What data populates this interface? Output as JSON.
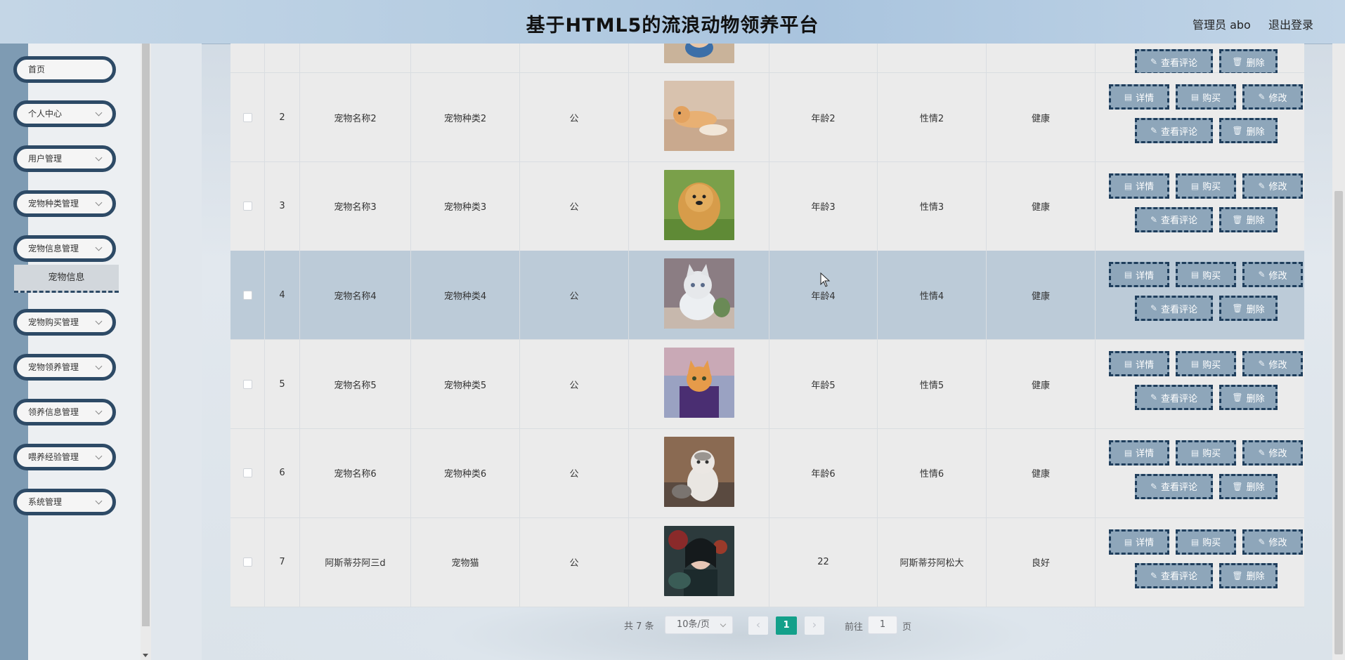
{
  "header": {
    "title": "基于HTML5的流浪动物领养平台",
    "admin_label": "管理员 abo",
    "logout_label": "退出登录"
  },
  "sidebar": {
    "items": [
      {
        "label": "首页",
        "expandable": false
      },
      {
        "label": "个人中心",
        "expandable": true
      },
      {
        "label": "用户管理",
        "expandable": true
      },
      {
        "label": "宠物种类管理",
        "expandable": true
      },
      {
        "label": "宠物信息管理",
        "expandable": true
      },
      {
        "label": "宠物购买管理",
        "expandable": true
      },
      {
        "label": "宠物领养管理",
        "expandable": true
      },
      {
        "label": "领养信息管理",
        "expandable": true
      },
      {
        "label": "喂养经验管理",
        "expandable": true
      },
      {
        "label": "系统管理",
        "expandable": true
      }
    ],
    "active_submenu": "宠物信息"
  },
  "table": {
    "action_labels": {
      "detail": "详情",
      "buy": "购买",
      "edit": "修改",
      "comments": "查看评论",
      "delete": "删除"
    },
    "partial_row_actions": {
      "comments": "查看评论",
      "delete": "删除"
    },
    "rows": [
      {
        "index": "2",
        "name": "宠物名称2",
        "type": "宠物种类2",
        "gender": "公",
        "age": "年龄2",
        "temperament": "性情2",
        "health": "健康",
        "photo": "cat-lying"
      },
      {
        "index": "3",
        "name": "宠物名称3",
        "type": "宠物种类3",
        "gender": "公",
        "age": "年龄3",
        "temperament": "性情3",
        "health": "健康",
        "photo": "chow-dog"
      },
      {
        "index": "4",
        "name": "宠物名称4",
        "type": "宠物种类4",
        "gender": "公",
        "age": "年龄4",
        "temperament": "性情4",
        "health": "健康",
        "photo": "white-kitten"
      },
      {
        "index": "5",
        "name": "宠物名称5",
        "type": "宠物种类5",
        "gender": "公",
        "age": "年龄5",
        "temperament": "性情5",
        "health": "健康",
        "photo": "kitten-in-bag"
      },
      {
        "index": "6",
        "name": "宠物名称6",
        "type": "宠物种类6",
        "gender": "公",
        "age": "年龄6",
        "temperament": "性情6",
        "health": "健康",
        "photo": "sitting-cat"
      },
      {
        "index": "7",
        "name": "阿斯蒂芬阿三d",
        "type": "宠物猫",
        "gender": "公",
        "age": "22",
        "temperament": "阿斯蒂芬阿松大",
        "health": "良好",
        "photo": "woman-portrait"
      }
    ],
    "highlighted_row_index": "4"
  },
  "pagination": {
    "total_label": "共 7 条",
    "page_size": "10条/页",
    "current_page": "1",
    "goto_prefix": "前往",
    "goto_value": "1",
    "goto_suffix": "页",
    "prev_icon": "chevron-left-icon",
    "next_icon": "chevron-right-icon"
  },
  "colors": {
    "accent": "#13a08a",
    "button_bg": "#8ea6ba",
    "button_border": "#1f3e5c",
    "menu_border": "#2d4a66",
    "highlight_row": "#bccbd8"
  }
}
